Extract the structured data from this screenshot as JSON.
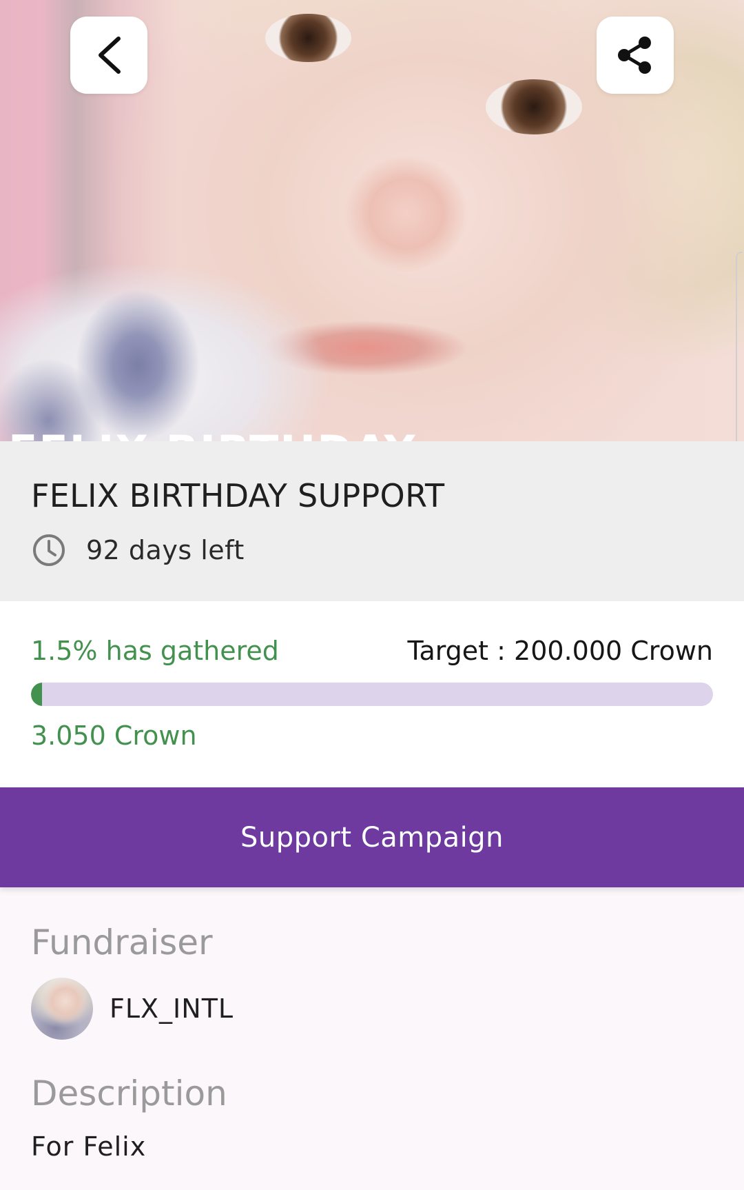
{
  "campaign": {
    "title": "FELIX BIRTHDAY SUPPORT",
    "banner_overlay_text": "FELIX BIRTHDAY",
    "days_left": "92 days left"
  },
  "progress": {
    "gathered_label": "1.5% has gathered",
    "target_label": "Target : 200.000 Crown",
    "amount_label": "3.050 Crown",
    "percent": 1.5
  },
  "actions": {
    "support_label": "Support Campaign"
  },
  "fundraiser": {
    "heading": "Fundraiser",
    "name": "FLX_INTL"
  },
  "description": {
    "heading": "Description",
    "text": "For Felix"
  },
  "icons": {
    "back": "chevron-left-icon",
    "share": "share-icon",
    "clock": "clock-icon"
  },
  "colors": {
    "accent_purple": "#6e3aa0",
    "progress_green": "#43914f",
    "progress_track": "#ddd3ea"
  }
}
